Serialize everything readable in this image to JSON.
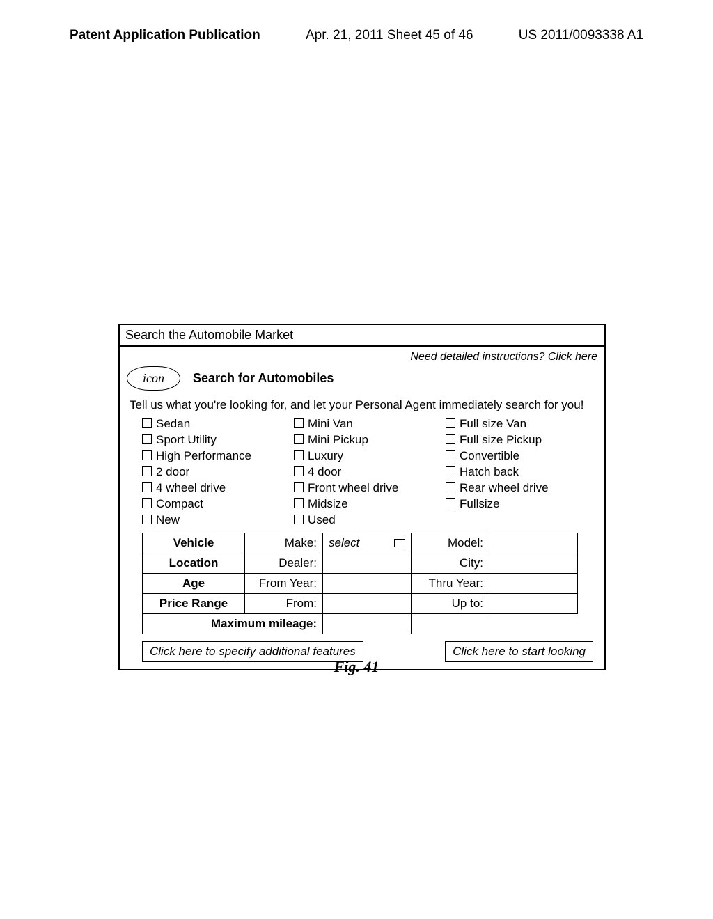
{
  "header": {
    "left": "Patent Application Publication",
    "mid": "Apr. 21, 2011  Sheet 45 of 46",
    "right": "US 2011/0093338 A1"
  },
  "panel": {
    "title": "Search the Automobile Market",
    "help_prefix": "Need detailed instructions?  ",
    "help_link": "Click here",
    "icon_label": "icon",
    "section_title": "Search for Automobiles",
    "intro": "Tell us what you're looking for, and let your Personal Agent immediately search for you!",
    "checks_col1": [
      "Sedan",
      "Sport Utility",
      "High Performance",
      "2 door",
      "4 wheel drive",
      "Compact",
      "New"
    ],
    "checks_col2": [
      "Mini Van",
      "Mini Pickup",
      "Luxury",
      "4 door",
      "Front wheel drive",
      "Midsize",
      "Used"
    ],
    "checks_col3": [
      "Full size Van",
      "Full size Pickup",
      "Convertible",
      "Hatch back",
      "Rear wheel drive",
      "Fullsize"
    ],
    "rows": {
      "vehicle": {
        "label": "Vehicle",
        "f1": "Make:",
        "v1": "select",
        "f2": "Model:",
        "v2": ""
      },
      "location": {
        "label": "Location",
        "f1": "Dealer:",
        "v1": "",
        "f2": "City:",
        "v2": ""
      },
      "age": {
        "label": "Age",
        "f1": "From Year:",
        "v1": "",
        "f2": "Thru Year:",
        "v2": ""
      },
      "price": {
        "label": "Price Range",
        "f1": "From:",
        "v1": "",
        "f2": "Up to:",
        "v2": ""
      },
      "mileage": {
        "label": "Maximum mileage:",
        "v": ""
      }
    },
    "btn_left": "Click here to specify additional features",
    "btn_right": "Click here to start looking"
  },
  "figure_label": "Fig. 41"
}
